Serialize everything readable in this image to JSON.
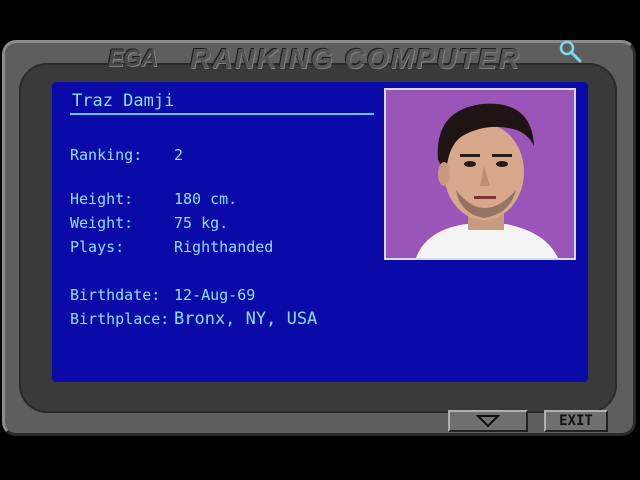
{
  "header": {
    "logo": "EGA",
    "title": "RANKING COMPUTER"
  },
  "player": {
    "name": "Traz Damji",
    "stats": [
      {
        "label": "Ranking:",
        "value": "2"
      },
      {
        "label": "Height:",
        "value": "180 cm."
      },
      {
        "label": "Weight:",
        "value": "75 kg."
      },
      {
        "label": "Plays:",
        "value": "Righthanded"
      },
      {
        "label": "Birthdate:",
        "value": "12-Aug-69"
      },
      {
        "label": "Birthplace:",
        "value": "Bronx, NY, USA"
      }
    ]
  },
  "footer": {
    "exit_label": "EXIT"
  },
  "colors": {
    "screen": "#0a0aa8",
    "text": "#8ae0ff",
    "frame": "#5e5e5e",
    "photo_background": "#9a55b8"
  },
  "icons": [
    "magnifier-icon",
    "down-arrow-icon"
  ]
}
